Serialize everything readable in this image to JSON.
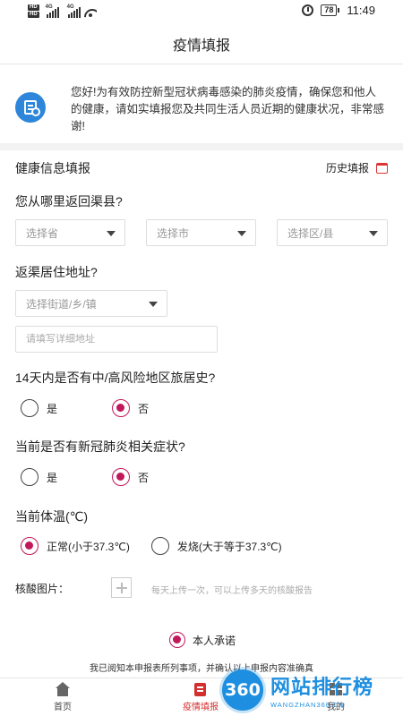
{
  "status_bar": {
    "hd1": "HD",
    "hd2": "HD",
    "net1": "4G",
    "net2": "4G",
    "battery": "78",
    "time": "11:49"
  },
  "header": {
    "title": "疫情填报"
  },
  "notice": {
    "text": "您好!为有效防控新型冠状病毒感染的肺炎疫情，确保您和他人的健康，请如实填报您及共同生活人员近期的健康状况，非常感谢!"
  },
  "form": {
    "section_title": "健康信息填报",
    "history_label": "历史填报",
    "q_return": {
      "label": "您从哪里返回渠县?",
      "province_placeholder": "选择省",
      "city_placeholder": "选择市",
      "district_placeholder": "选择区/县"
    },
    "q_address": {
      "label": "返渠居住地址?",
      "street_placeholder": "选择街道/乡/镇",
      "detail_placeholder": "请填写详细地址"
    },
    "q_risk_area": {
      "label": "14天内是否有中/高风险地区旅居史?",
      "options": [
        "是",
        "否"
      ],
      "selected": "否"
    },
    "q_symptoms": {
      "label": "当前是否有新冠肺炎相关症状?",
      "options": [
        "是",
        "否"
      ],
      "selected": "否"
    },
    "q_temperature": {
      "label": "当前体温(℃)",
      "options": [
        "正常(小于37.3℃)",
        "发烧(大于等于37.3℃)"
      ],
      "selected": "正常(小于37.3℃)"
    },
    "upload": {
      "label": "核酸图片：",
      "hint": "每天上传一次，可以上传多天的核酸报告"
    },
    "promise_label": "本人承诺",
    "disclaimer": "我已阅知本申报表所列事项，并确认以上申报内容准确真"
  },
  "tabs": [
    {
      "label": "首页",
      "icon": "home-icon"
    },
    {
      "label": "疫情填报",
      "icon": "report-icon"
    },
    {
      "label": "我的",
      "icon": "mine-icon"
    }
  ],
  "watermark": {
    "logo": "360",
    "title": "网站排行榜",
    "url": "WANGZHAN360.CN"
  },
  "colors": {
    "accent": "#c2185b",
    "notice_icon": "#2d86d9",
    "active_tab": "#d32f2f",
    "watermark": "#1e8fe0"
  }
}
